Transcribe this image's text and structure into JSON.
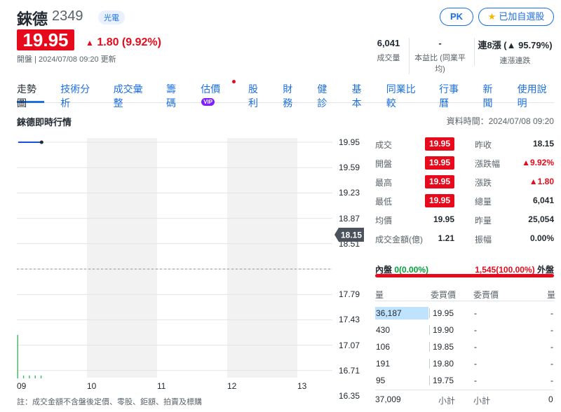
{
  "stock": {
    "name": "錸德",
    "code": "2349",
    "sector": "光電",
    "price": "19.95",
    "change": "1.80 (9.92%)",
    "status": "開盤 | 2024/07/08 09:20 更新"
  },
  "actions": {
    "pk_label": "PK",
    "watchlist_label": "已加自選股"
  },
  "stats": {
    "volume_value": "6,041",
    "volume_label": "成交量",
    "pe_value": "-",
    "pe_label": "本益比 (同業平均)",
    "streak_value": "連8漲 (▲ 95.79%)",
    "streak_label": "連漲連跌"
  },
  "nav": {
    "items": [
      "走勢圖",
      "技術分析",
      "成交彙整",
      "籌碼",
      "估價",
      "股利",
      "財務",
      "健診",
      "基本",
      "同業比較",
      "行事曆",
      "新聞",
      "使用說明"
    ],
    "vip_label": "VIP"
  },
  "section": {
    "title": "錸德即時行情",
    "data_time": "資料時間：2024/07/08 09:20"
  },
  "chart_data": {
    "type": "line",
    "x_ticks": [
      "09",
      "10",
      "11",
      "12",
      "13"
    ],
    "y_ticks": [
      "19.95",
      "19.59",
      "19.23",
      "18.87",
      "18.51",
      "18.15",
      "17.79",
      "17.43",
      "17.07",
      "16.71",
      "16.35"
    ],
    "ylim": [
      16.35,
      19.95
    ],
    "prev_close": "18.15",
    "price_series": [
      {
        "time": "09:00",
        "price": 19.95
      },
      {
        "time": "09:20",
        "price": 19.95
      }
    ],
    "volume_bars": [
      {
        "time": "09:00",
        "volume": 5900
      },
      {
        "time": "09:05",
        "volume": 45
      },
      {
        "time": "09:10",
        "volume": 40
      },
      {
        "time": "09:15",
        "volume": 35
      },
      {
        "time": "09:20",
        "volume": 25
      }
    ]
  },
  "quote": {
    "rows_left": [
      {
        "label": "成交",
        "value": "19.95",
        "badge": true
      },
      {
        "label": "開盤",
        "value": "19.95",
        "badge": true
      },
      {
        "label": "最高",
        "value": "19.95",
        "badge": true
      },
      {
        "label": "最低",
        "value": "19.95",
        "badge": true
      },
      {
        "label": "均價",
        "value": "19.95",
        "badge": false
      },
      {
        "label": "成交金額(億)",
        "value": "1.21",
        "badge": false
      }
    ],
    "rows_right": [
      {
        "label": "昨收",
        "value": "18.15"
      },
      {
        "label": "漲跌幅",
        "value": "▲9.92%"
      },
      {
        "label": "漲跌",
        "value": "▲1.80"
      },
      {
        "label": "總量",
        "value": "6,041"
      },
      {
        "label": "昨量",
        "value": "25,054"
      },
      {
        "label": "振幅",
        "value": "0.00%"
      }
    ],
    "inner_label": "內盤",
    "inner_value": "0(0.00%)",
    "outer_value": "1,545(100.00%)",
    "outer_label": "外盤"
  },
  "order_book": {
    "head": [
      "量",
      "委買價",
      "委賣價",
      "量"
    ],
    "bids": [
      {
        "qty": "36,187",
        "price": "19.95",
        "share": 1.0
      },
      {
        "qty": "430",
        "price": "19.90",
        "share": 0
      },
      {
        "qty": "106",
        "price": "19.85",
        "share": 0
      },
      {
        "qty": "191",
        "price": "19.80",
        "share": 0
      },
      {
        "qty": "95",
        "price": "19.75",
        "share": 0
      }
    ],
    "asks": [
      {
        "price": "-",
        "qty": "-"
      },
      {
        "price": "-",
        "qty": "-"
      },
      {
        "price": "-",
        "qty": "-"
      },
      {
        "price": "-",
        "qty": "-"
      },
      {
        "price": "-",
        "qty": "-"
      }
    ],
    "bid_total": "37,009",
    "bid_total_label": "小計",
    "ask_total_label": "小計",
    "ask_total": "0"
  },
  "footnote": "註：成交金額不含盤後定價、零股、鉅額、拍賣及標購",
  "colors": {
    "up": "#e60a1c",
    "down": "#00a13b",
    "link": "#1d6fe0",
    "volume": "#4cb96b",
    "line": "#1d4ed8",
    "bid_share": "#bfe3ff"
  }
}
